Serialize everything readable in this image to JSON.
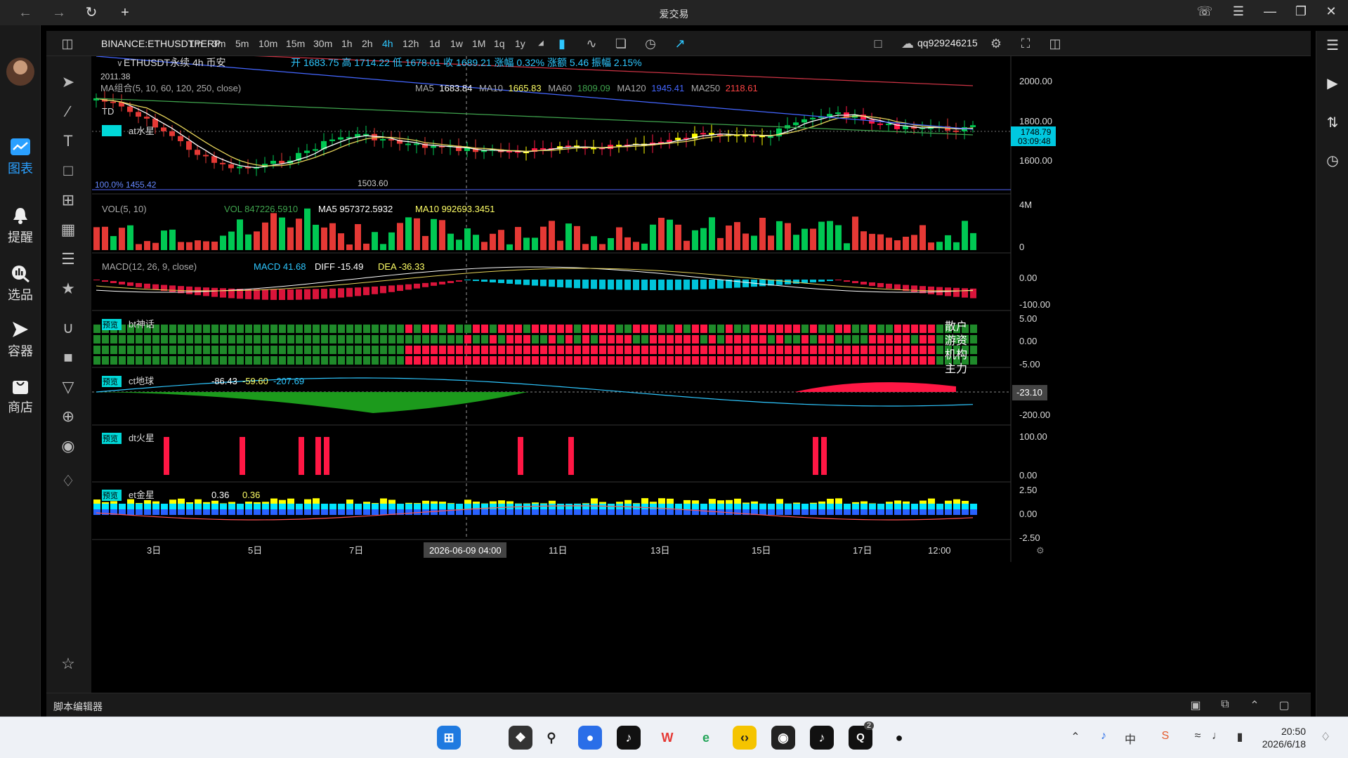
{
  "window": {
    "title": "爱交易"
  },
  "nav": [
    {
      "label": "图表",
      "icon": "chart-icon",
      "active": true
    },
    {
      "label": "提醒",
      "icon": "bell-icon"
    },
    {
      "label": "选品",
      "icon": "search-chart-icon"
    },
    {
      "label": "容器",
      "icon": "arrow-right-icon"
    },
    {
      "label": "商店",
      "icon": "bag-icon"
    }
  ],
  "toolbar": {
    "symbol": "BINANCE:ETHUSDTPERP",
    "timeframes": [
      "1m",
      "3m",
      "5m",
      "10m",
      "15m",
      "30m",
      "1h",
      "2h",
      "4h",
      "12h",
      "1d",
      "1w",
      "1M",
      "1q",
      "1y"
    ],
    "active_timeframe": "4h",
    "account": "qq929246215"
  },
  "main_panel": {
    "header": "ETHUSDT永续 4h 币安",
    "ohlc": "开 1683.75 高 1714.22 低 1678.01 收 1689.21 涨幅 0.32% 涨额 5.46 振幅 2.15%",
    "ma_label": "MA组合(5, 10, 60, 120, 250, close)",
    "ma_prefix": [
      "MA5",
      "MA10",
      "MA60",
      "MA120",
      "MA250"
    ],
    "ma_values": [
      "1683.84",
      "1665.83",
      "1809.09",
      "1945.41",
      "2118.61"
    ],
    "td_label": "TD",
    "at_label": "at水星",
    "high_marker": "2011.38",
    "low_marker": "1503.60",
    "fib_label": "100.0% 1455.42",
    "price_ticks": [
      "2000.00",
      "1800.00",
      "1600.00"
    ],
    "last_price": "1748.79",
    "countdown": "03:09:48"
  },
  "vol_panel": {
    "label": "VOL(5, 10)",
    "vol_text": "VOL 847226.5910",
    "ma5_text": "MA5 957372.5932",
    "ma10_text": "MA10 992693.3451",
    "ticks": [
      "4M",
      "0"
    ]
  },
  "macd_panel": {
    "label": "MACD(12, 26, 9, close)",
    "macd_text": "MACD 41.68",
    "diff_text": "DIFF -15.49",
    "dea_text": "DEA -36.33",
    "ticks": [
      "0.00",
      "-100.00"
    ]
  },
  "bt_panel": {
    "badge": "预览",
    "label": "bt神话",
    "legend": [
      "散户",
      "游资",
      "机构",
      "主力"
    ],
    "ticks": [
      "5.00",
      "0.00",
      "-5.00"
    ]
  },
  "ct_panel": {
    "badge": "预览",
    "label": "ct地球",
    "v1": "-86.43",
    "v2": "-59.60",
    "v3": "-207.69",
    "ticks": [
      "-200.00"
    ],
    "current": "-23.10"
  },
  "dt_panel": {
    "badge": "预览",
    "label": "dt火星",
    "ticks": [
      "100.00",
      "0.00"
    ]
  },
  "et_panel": {
    "badge": "预览",
    "label": "et金星",
    "v1": "0.36",
    "v2": "0.36",
    "ticks": [
      "2.50",
      "0.00",
      "-2.50"
    ]
  },
  "time_axis": {
    "labels": [
      "3日",
      "5日",
      "7日",
      "11日",
      "13日",
      "15日",
      "17日",
      "12:00"
    ],
    "cursor": "2026-06-09  04:00"
  },
  "script_editor": {
    "label": "脚本编辑器"
  },
  "taskbar": {
    "time": "20:50",
    "date": "2026/6/18",
    "notification_count": "2"
  },
  "colors": {
    "up": "#00c853",
    "down": "#ff1744",
    "accent": "#2ec7ff",
    "yellow": "#ffff00"
  }
}
